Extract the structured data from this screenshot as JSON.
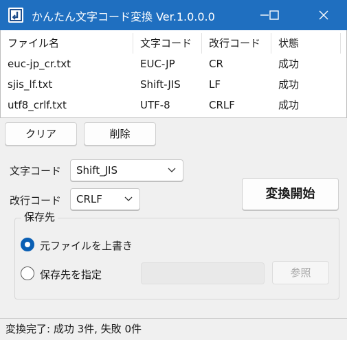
{
  "window": {
    "title": "かんたん文字コード変換 Ver.1.0.0.0",
    "title_color": "#1f6fc0"
  },
  "table": {
    "columns": [
      "ファイル名",
      "文字コード",
      "改行コード",
      "状態"
    ],
    "rows": [
      [
        "euc-jp_cr.txt",
        "EUC-JP",
        "CR",
        "成功"
      ],
      [
        "sjis_lf.txt",
        "Shift-JIS",
        "LF",
        "成功"
      ],
      [
        "utf8_crlf.txt",
        "UTF-8",
        "CRLF",
        "成功"
      ]
    ]
  },
  "buttons": {
    "clear": "クリア",
    "delete": "削除",
    "convert": "変換開始",
    "browse": "参照"
  },
  "encoding": {
    "label": "文字コード",
    "selected": "Shift_JIS"
  },
  "newline": {
    "label": "改行コード",
    "selected": "CRLF"
  },
  "save": {
    "group_title": "保存先",
    "overwrite_label": "元ファイルを上書き",
    "overwrite_checked": true,
    "specify_label": "保存先を指定",
    "specify_checked": false,
    "path_value": ""
  },
  "status": {
    "text": "変換完了: 成功 3件, 失敗 0件"
  },
  "icons": {
    "app": "app-document-icon",
    "minimize": "minimize-icon",
    "maximize": "maximize-icon",
    "close": "close-icon",
    "dropdown": "chevron-down-icon",
    "accent": "#0a5fb4"
  }
}
